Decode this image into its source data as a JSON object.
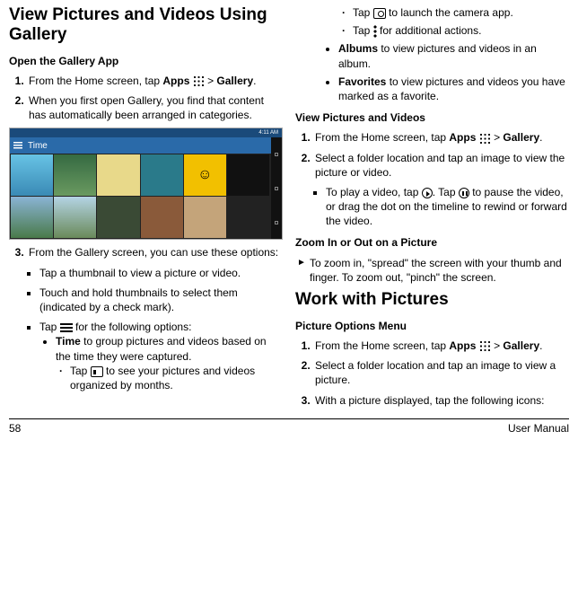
{
  "footer": {
    "page": "58",
    "label": "User Manual"
  },
  "col1": {
    "h2": "View Pictures and Videos Using Gallery",
    "h3_open": "Open the Gallery App",
    "s1": {
      "pre": "From the Home screen, tap ",
      "apps": "Apps",
      "post": " > ",
      "gallery": "Gallery",
      "end": "."
    },
    "s2": "When you first open Gallery, you find that content has automatically been arranged in categories.",
    "sc": {
      "time": "4:11 AM",
      "title": "Time"
    },
    "s3": "From the Gallery screen, you can use these options:",
    "b_thumb": "Tap a thumbnail to view a picture or video.",
    "b_hold": "Touch and hold thumbnails to select them (indicated by a check mark).",
    "b_menu": {
      "pre": "Tap ",
      "post": " for the following options:"
    },
    "time_opt": {
      "b": "Time",
      "t": " to group pictures and videos based on the time they were captured."
    },
    "month": {
      "pre": "Tap ",
      "post": " to see your pictures and videos organized by months."
    }
  },
  "col2": {
    "cam": {
      "pre": "Tap ",
      "post": " to launch the camera app."
    },
    "more": {
      "pre": "Tap ",
      "post": " for additional actions."
    },
    "albums": {
      "b": "Albums",
      "t": " to view pictures and videos in an album."
    },
    "fav": {
      "b": "Favorites",
      "t": " to view pictures and videos you have marked as a favorite."
    },
    "h3_view": "View Pictures and Videos",
    "v1": {
      "pre": "From the Home screen, tap ",
      "apps": "Apps",
      "post": " > ",
      "gallery": "Gallery",
      "end": "."
    },
    "v2": "Select a folder location and tap an image to view the picture or video.",
    "play": {
      "pre": "To play a video, tap ",
      "mid": ". Tap ",
      "post": " to pause the video, or drag the dot on the timeline to rewind or forward the video."
    },
    "h3_zoom": "Zoom In or Out on a Picture",
    "zoom": "To zoom in, \"spread\" the screen with your thumb and finger. To zoom out, \"pinch\" the screen.",
    "h2": "Work with Pictures",
    "h3_opt": "Picture Options Menu",
    "p1": {
      "pre": "From the Home screen, tap ",
      "apps": "Apps",
      "post": " > ",
      "gallery": "Gallery",
      "end": "."
    },
    "p2": "Select a folder location and tap an image to view a picture.",
    "p3": "With a picture displayed, tap the following icons:"
  }
}
